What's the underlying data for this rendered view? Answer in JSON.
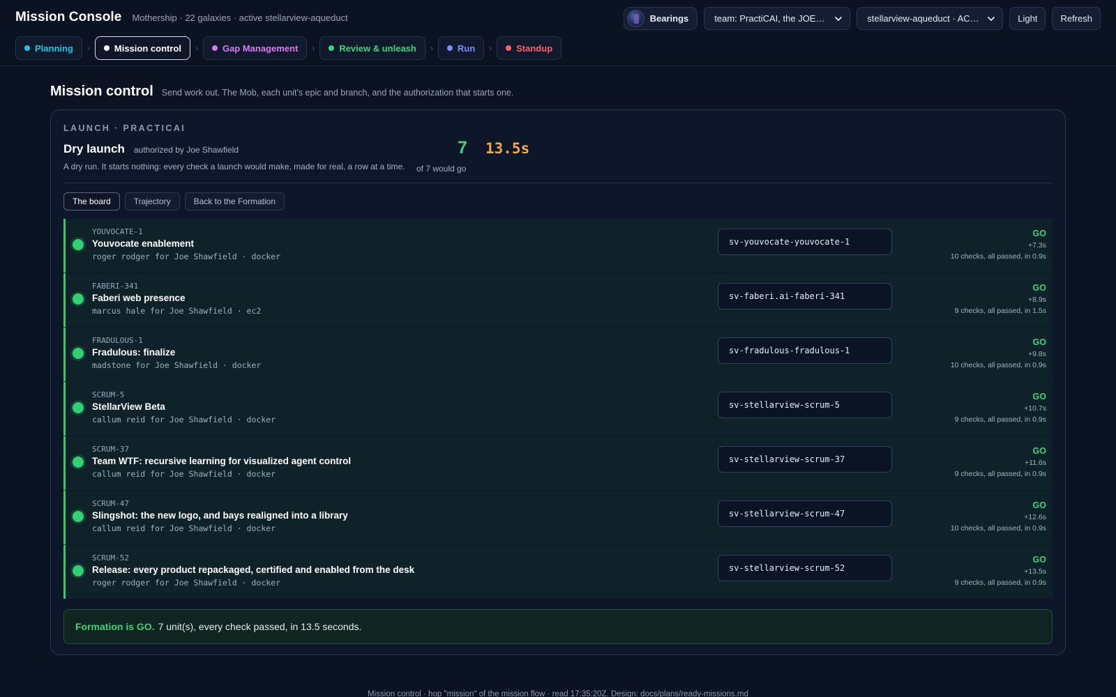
{
  "app": {
    "title": "Mission Console",
    "subtitle": "Mothership · 22 galaxies · active stellarview-aqueduct"
  },
  "controls": {
    "bearings_label": "Bearings",
    "team_select": "team: PractiCAI, the JOEY…",
    "galaxy_select": "stellarview-aqueduct · AC…",
    "theme_label": "Light",
    "refresh_label": "Refresh"
  },
  "tabs": [
    {
      "label": "Planning",
      "color": "#22c4e0",
      "active": false
    },
    {
      "label": "Mission control",
      "color": "#ffffff",
      "active": true
    },
    {
      "label": "Gap Management",
      "color": "#d979f2",
      "active": false
    },
    {
      "label": "Review & unleash",
      "color": "#3fd27a",
      "active": false
    },
    {
      "label": "Run",
      "color": "#7c8cff",
      "active": false
    },
    {
      "label": "Standup",
      "color": "#ff5e6c",
      "active": false
    }
  ],
  "page": {
    "title": "Mission control",
    "description": "Send work out. The Mob, each unit's epic and branch, and the authorization that starts one."
  },
  "launch": {
    "kicker": "LAUNCH · PRACTICAI",
    "title": "Dry launch",
    "authorized": "authorized by Joe Shawfield",
    "description": "A dry run. It starts nothing: every check a launch would make, made for real, a row at a time.",
    "go_count": "7",
    "go_count_label": "of 7 would go",
    "elapsed": "13.5s",
    "view_tabs": [
      {
        "label": "The board",
        "active": true
      },
      {
        "label": "Trajectory",
        "active": false
      },
      {
        "label": "Back to the Formation",
        "active": false
      }
    ]
  },
  "units": [
    {
      "key": "YOUVOCATE-1",
      "title": "Youvocate enablement",
      "owner": "roger rodger for Joe Shawfield · docker",
      "branch": "sv-youvocate-youvocate-1",
      "verdict": "GO",
      "offset": "+7.3s",
      "checks": "10 checks, all passed, in 0.9s"
    },
    {
      "key": "FABERI-341",
      "title": "Faberi web presence",
      "owner": "marcus hale for Joe Shawfield · ec2",
      "branch": "sv-faberi.ai-faberi-341",
      "verdict": "GO",
      "offset": "+8.9s",
      "checks": "9 checks, all passed, in 1.5s"
    },
    {
      "key": "FRADULOUS-1",
      "title": "Fradulous: finalize",
      "owner": "madstone for Joe Shawfield · docker",
      "branch": "sv-fradulous-fradulous-1",
      "verdict": "GO",
      "offset": "+9.8s",
      "checks": "10 checks, all passed, in 0.9s"
    },
    {
      "key": "SCRUM-5",
      "title": "StellarView Beta",
      "owner": "callum reid for Joe Shawfield · docker",
      "branch": "sv-stellarview-scrum-5",
      "verdict": "GO",
      "offset": "+10.7s",
      "checks": "9 checks, all passed, in 0.9s"
    },
    {
      "key": "SCRUM-37",
      "title": "Team WTF: recursive learning for visualized agent control",
      "owner": "callum reid for Joe Shawfield · docker",
      "branch": "sv-stellarview-scrum-37",
      "verdict": "GO",
      "offset": "+11.6s",
      "checks": "9 checks, all passed, in 0.9s"
    },
    {
      "key": "SCRUM-47",
      "title": "Slingshot: the new logo, and bays realigned into a library",
      "owner": "callum reid for Joe Shawfield · docker",
      "branch": "sv-stellarview-scrum-47",
      "verdict": "GO",
      "offset": "+12.6s",
      "checks": "10 checks, all passed, in 0.9s"
    },
    {
      "key": "SCRUM-52",
      "title": "Release: every product repackaged, certified and enabled from the desk",
      "owner": "roger rodger for Joe Shawfield · docker",
      "branch": "sv-stellarview-scrum-52",
      "verdict": "GO",
      "offset": "+13.5s",
      "checks": "9 checks, all passed, in 0.9s"
    }
  ],
  "banner": {
    "strong": "Formation is GO.",
    "text": "7 unit(s), every check passed, in 13.5 seconds."
  },
  "footer": "Mission control · hop \"mission\" of the mission flow · read 17:35:20Z. Design: docs/plans/ready-missions.md",
  "colors": {
    "background": "#0b1222",
    "go_green": "#3fd27a",
    "elapsed_amber": "#f0a84a"
  }
}
